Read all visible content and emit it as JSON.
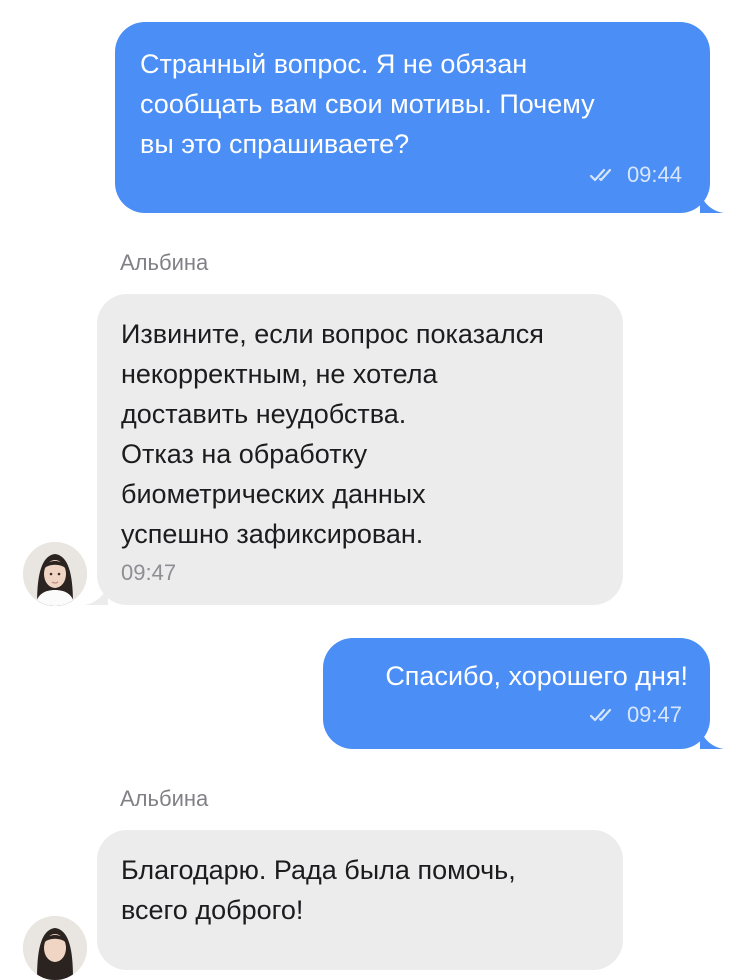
{
  "messages": [
    {
      "direction": "outgoing",
      "text": "Странный вопрос. Я не обязан\nсообщать вам свои мотивы. Почему\nвы это спрашиваете?",
      "time": "09:44",
      "status": "read-double-check-icon"
    },
    {
      "direction": "incoming",
      "sender": "Альбина",
      "text": "Извините, если вопрос показался\nнекорректным, не хотела\nдоставить неудобства.\nОтказ на обработку\nбиометрических данных\nуспешно зафиксирован.",
      "time": "09:47"
    },
    {
      "direction": "outgoing",
      "text": "Спасибо, хорошего дня!",
      "time": "09:47",
      "status": "read-double-check-icon"
    },
    {
      "direction": "incoming",
      "sender": "Альбина",
      "text": "Благодарю. Рада была помочь,\nвсего доброго!",
      "time": ""
    }
  ],
  "colors": {
    "outgoing_bubble": "#4a8ef6",
    "incoming_bubble": "#ececed",
    "sender_name": "#808087",
    "timestamp_incoming": "#8e8e93"
  }
}
